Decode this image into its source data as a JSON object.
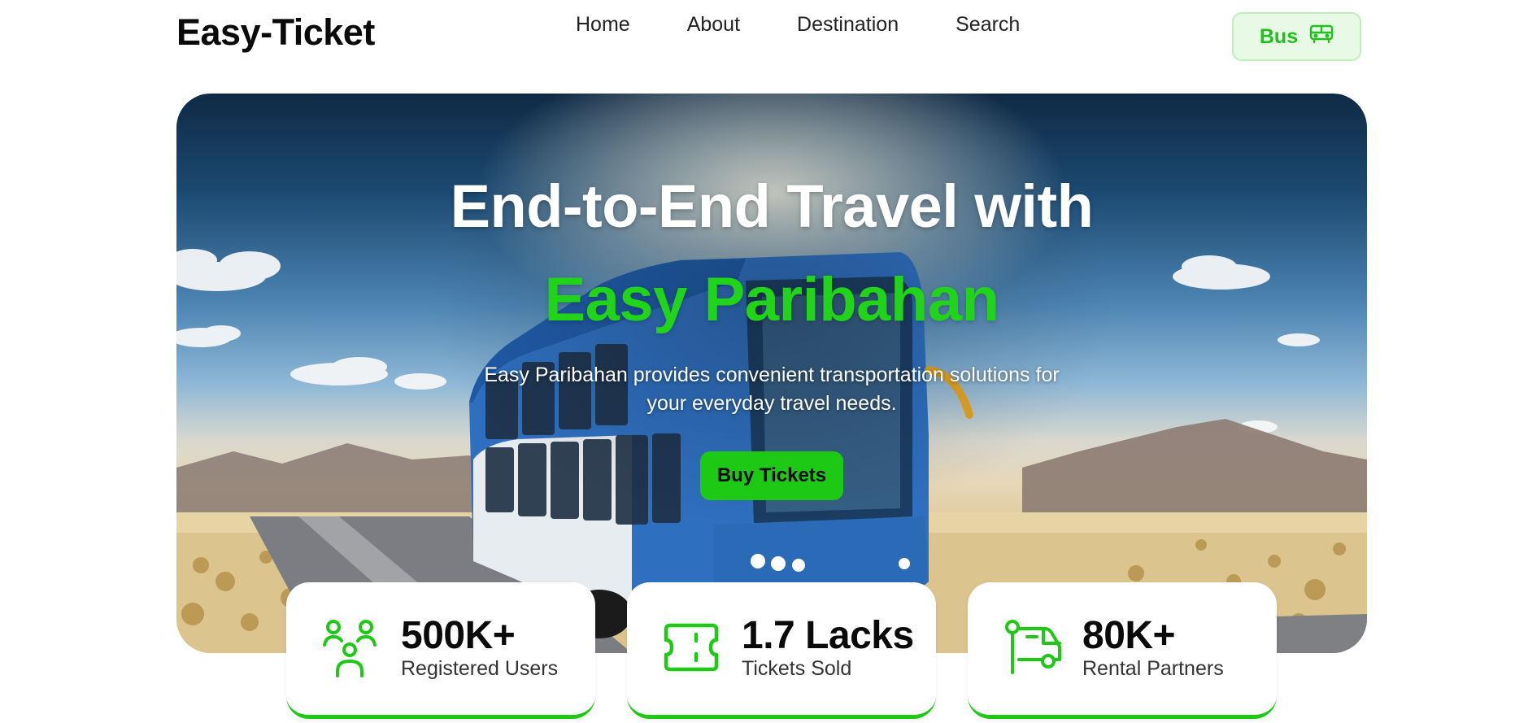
{
  "brand": {
    "logo": "Easy-Ticket"
  },
  "nav": {
    "links": [
      "Home",
      "About",
      "Destination",
      "Search"
    ],
    "bus_button": {
      "label": "Bus",
      "icon": "bus-icon"
    }
  },
  "hero": {
    "title": "End-to-End Travel with",
    "brand_name": "Easy Paribahan",
    "description": "Easy Paribahan provides convenient transportation solutions for your everyday travel needs.",
    "cta_label": "Buy Tickets"
  },
  "stats": [
    {
      "value": "500K+",
      "label": "Registered Users",
      "icon": "users-icon"
    },
    {
      "value": "1.7 Lacks",
      "label": "Tickets Sold",
      "icon": "ticket-icon"
    },
    {
      "value": "80K+",
      "label": "Rental Partners",
      "icon": "truck-icon"
    }
  ],
  "colors": {
    "accent": "#1ec916",
    "accent_light": "#e8fae6",
    "text_dark": "#0a0a0a"
  }
}
